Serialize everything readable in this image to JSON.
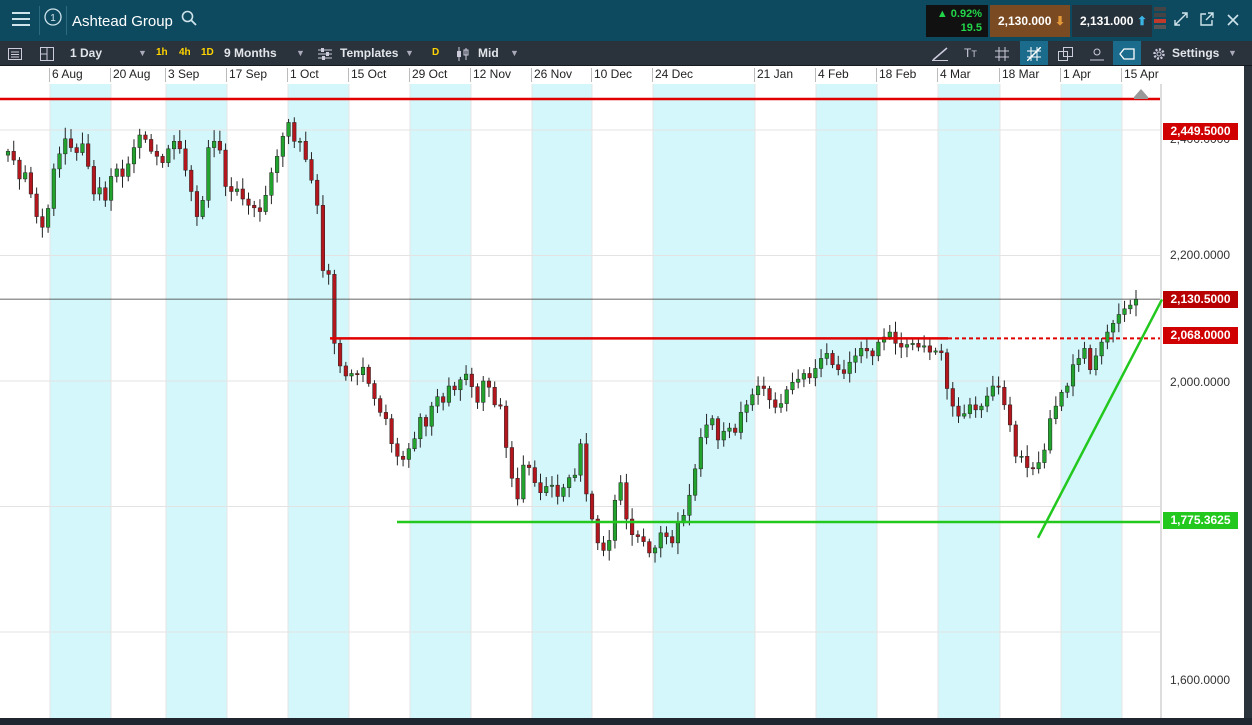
{
  "app": {
    "title": "Ashtead Group",
    "change_pct": "▲ 0.92%",
    "change_pts": "19.5",
    "sell_price": "2,130.000",
    "buy_price": "2,131.000"
  },
  "toolbar": {
    "interval": "1 Day",
    "quick_1h": "1h",
    "quick_4h": "4h",
    "quick_1d": "1D",
    "range": "9 Months",
    "templates": "Templates",
    "price_type_badge": "D",
    "price_type": "Mid",
    "settings": "Settings"
  },
  "icons": {
    "menu": "menu-icon",
    "info": "info-icon",
    "search": "search-icon",
    "list": "list-icon",
    "layout": "layout-icon",
    "templates": "sliders-icon",
    "candles": "candles-icon",
    "expand": "expand-icon",
    "popout": "popout-icon",
    "close": "close-icon",
    "settings": "gear-icon"
  },
  "colors": {
    "up": "#22a32e",
    "down": "#b3161d",
    "band": "#d4f7fb",
    "resistance": "#e00000",
    "support": "#22c81e"
  },
  "chart_data": {
    "type": "candlestick",
    "title": "Ashtead Group",
    "x_ticks": [
      "6 Aug",
      "20 Aug",
      "3 Sep",
      "17 Sep",
      "1 Oct",
      "15 Oct",
      "29 Oct",
      "12 Nov",
      "26 Nov",
      "10 Dec",
      "24 Dec",
      "21 Jan",
      "4 Feb",
      "18 Feb",
      "4 Mar",
      "18 Mar",
      "1 Apr",
      "15 Apr"
    ],
    "y_ticks": [
      "2,400.0000",
      "2,200.0000",
      "2,000.0000",
      "1,600.0000"
    ],
    "ylim": [
      1600,
      2400
    ],
    "current_price_label": "2,130.5000",
    "horizontal_lines": [
      {
        "label": "2,449.5000",
        "value": 2449.5,
        "color": "red"
      },
      {
        "label": "2,068.0000",
        "value": 2068.0,
        "color": "red"
      },
      {
        "label": "1,775.3625",
        "value": 1775.3625,
        "color": "green"
      }
    ],
    "trendline": {
      "from": {
        "date": "22 Mar",
        "value": 1750
      },
      "to": {
        "date": "18 Apr",
        "value": 2130
      }
    },
    "closes": [
      2366,
      2352,
      2322,
      2332,
      2298,
      2262,
      2245,
      2275,
      2338,
      2362,
      2386,
      2372,
      2364,
      2378,
      2342,
      2298,
      2308,
      2288,
      2326,
      2338,
      2326,
      2346,
      2372,
      2392,
      2385,
      2366,
      2358,
      2348,
      2370,
      2382,
      2370,
      2336,
      2302,
      2262,
      2288,
      2372,
      2382,
      2368,
      2310,
      2302,
      2306,
      2290,
      2280,
      2276,
      2270,
      2296,
      2332,
      2358,
      2390,
      2412,
      2382,
      2382,
      2353,
      2320,
      2280,
      2176,
      2170,
      2060,
      2024,
      2008,
      2012,
      2010,
      2022,
      1996,
      1972,
      1950,
      1940,
      1900,
      1880,
      1875,
      1892,
      1908,
      1942,
      1928,
      1960,
      1975,
      1966,
      1992,
      1986,
      2002,
      2011,
      1991,
      1966,
      2000,
      1990,
      1962,
      1960,
      1894,
      1845,
      1812,
      1866,
      1862,
      1838,
      1822,
      1832,
      1834,
      1816,
      1830,
      1846,
      1850,
      1900,
      1820,
      1780,
      1742,
      1730,
      1746,
      1810,
      1838,
      1780,
      1755,
      1752,
      1744,
      1726,
      1734,
      1758,
      1752,
      1742,
      1774,
      1786,
      1818,
      1860,
      1910,
      1930,
      1940,
      1906,
      1920,
      1925,
      1918,
      1950,
      1962,
      1978,
      1992,
      1988,
      1970,
      1958,
      1964,
      1986,
      1998,
      2003,
      2012,
      2005,
      2020,
      2036,
      2044,
      2026,
      2018,
      2012,
      2030,
      2040,
      2052,
      2048,
      2040,
      2062,
      2070,
      2078,
      2060,
      2054,
      2058,
      2060,
      2054,
      2056,
      2046,
      2048,
      2045,
      1988,
      1960,
      1944,
      1948,
      1962,
      1954,
      1960,
      1976,
      1992,
      1990,
      1962,
      1930,
      1880,
      1880,
      1862,
      1860,
      1870,
      1890,
      1940,
      1960,
      1982,
      1992,
      2026,
      2036,
      2052,
      2018,
      2040,
      2062,
      2078,
      2092,
      2106,
      2115,
      2121,
      2130
    ]
  }
}
